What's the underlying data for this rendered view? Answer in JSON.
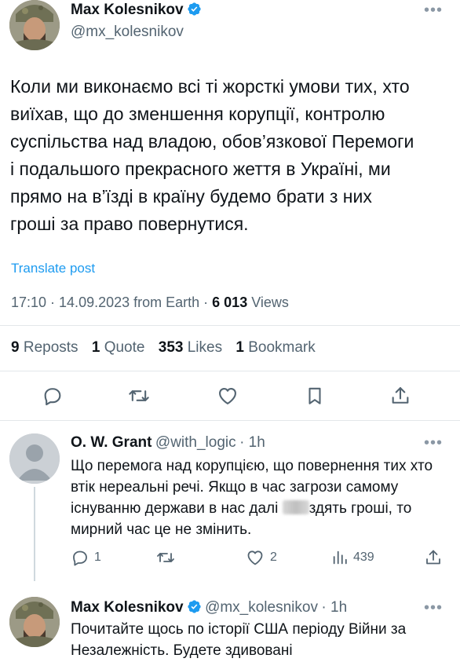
{
  "main_post": {
    "author_name": "Max Kolesnikov",
    "author_handle": "@mx_kolesnikov",
    "text": "Коли ми виконаємо всі ті жорсткі умови тих, хто виїхав, що до зменшення корупції, контролю суспільства над владою, обов’язкової Перемоги і подальшого прекрасного жеття в Україні, ми прямо на в’їзді в країну будемо брати з них гроші за право повернутися.",
    "translate_label": "Translate post",
    "timestamp": "17:10 · 14.09.2023 from Earth · ",
    "views_count": "6 013",
    "views_label": " Views",
    "stats": {
      "reposts_count": "9",
      "reposts_label": "Reposts",
      "quotes_count": "1",
      "quotes_label": "Quote",
      "likes_count": "353",
      "likes_label": "Likes",
      "bookmarks_count": "1",
      "bookmarks_label": "Bookmark"
    }
  },
  "replies": [
    {
      "author_name": "O. W. Grant",
      "author_handle": "@with_logic",
      "time": "· 1h",
      "text_before_blur": "Що перемога над корупцією, що повернення тих хто втік нереальні речі. Якщо в час загрози самому існуванню держави в нас далі ",
      "text_after_blur": "здять гроші,  то мирний час це не змінить.",
      "reply_count": "1",
      "like_count": "2",
      "view_count": "439"
    },
    {
      "author_name": "Max Kolesnikov",
      "author_handle": "@mx_kolesnikov",
      "time": "· 1h",
      "text": "Почитайте щось по історії США періоду Війни за Незалежність. Будете здивовані"
    }
  ],
  "colors": {
    "accent": "#1d9bf0",
    "secondary_text": "#536471",
    "divider": "#e3e7ea"
  },
  "icons": [
    "verified-badge-icon",
    "more-icon",
    "reply-icon",
    "repost-icon",
    "like-icon",
    "bookmark-icon",
    "share-icon",
    "views-icon"
  ]
}
